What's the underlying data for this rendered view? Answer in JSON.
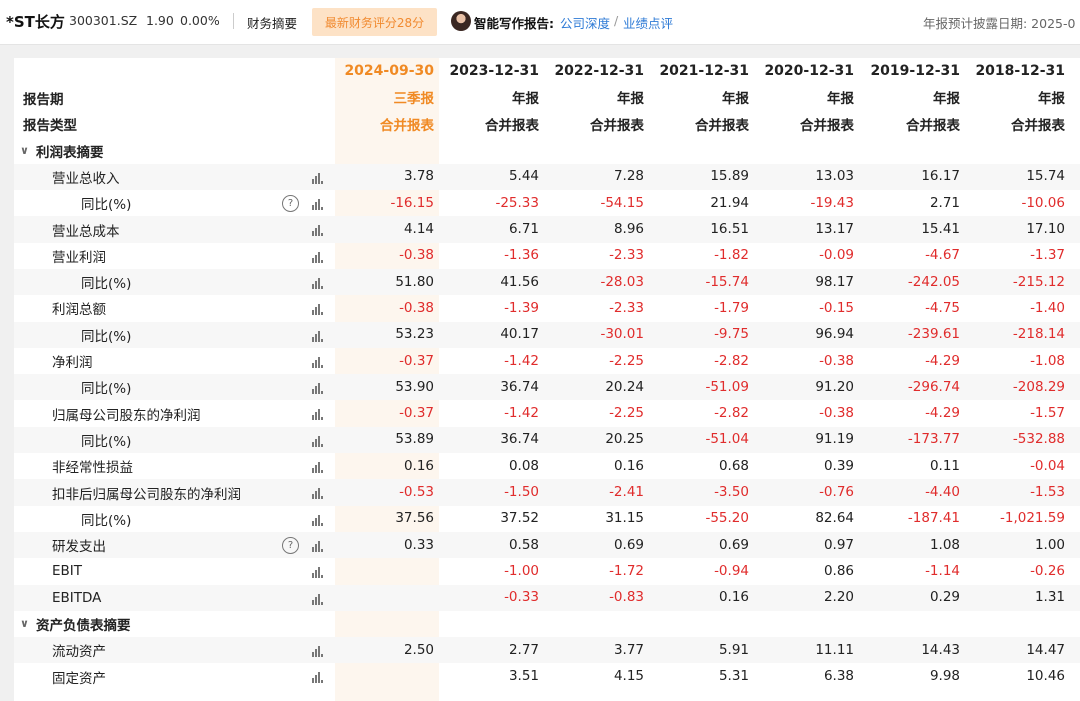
{
  "topbar": {
    "stock_name": "*ST长方",
    "stock_code": "300301.SZ",
    "price": "1.90",
    "change": "0.00%",
    "tab_summary": "财务摘要",
    "score_button": "最新财务评分28分",
    "ai_label": "智能写作报告:",
    "ai_link1": "公司深度",
    "ai_sep": "/",
    "ai_link2": "业绩点评",
    "disclosure": "年报预计披露日期: 2025-0"
  },
  "header": {
    "dates": [
      "2024-09-30",
      "2023-12-31",
      "2022-12-31",
      "2021-12-31",
      "2020-12-31",
      "2019-12-31",
      "2018-12-31"
    ],
    "period_label": "报告期",
    "periods": [
      "三季报",
      "年报",
      "年报",
      "年报",
      "年报",
      "年报",
      "年报"
    ],
    "type_label": "报告类型",
    "types": [
      "合并报表",
      "合并报表",
      "合并报表",
      "合并报表",
      "合并报表",
      "合并报表",
      "合并报表"
    ]
  },
  "sections": {
    "income": "利润表摘要",
    "balance": "资产负债表摘要"
  },
  "rows": [
    {
      "label": "营业总收入",
      "level": 1,
      "help": false,
      "values": [
        "3.78",
        "5.44",
        "7.28",
        "15.89",
        "13.03",
        "16.17",
        "15.74"
      ]
    },
    {
      "label": "同比(%)",
      "level": 2,
      "help": true,
      "values": [
        "-16.15",
        "-25.33",
        "-54.15",
        "21.94",
        "-19.43",
        "2.71",
        "-10.06"
      ]
    },
    {
      "label": "营业总成本",
      "level": 1,
      "help": false,
      "values": [
        "4.14",
        "6.71",
        "8.96",
        "16.51",
        "13.17",
        "15.41",
        "17.10"
      ]
    },
    {
      "label": "营业利润",
      "level": 1,
      "help": false,
      "values": [
        "-0.38",
        "-1.36",
        "-2.33",
        "-1.82",
        "-0.09",
        "-4.67",
        "-1.37"
      ]
    },
    {
      "label": "同比(%)",
      "level": 2,
      "help": false,
      "values": [
        "51.80",
        "41.56",
        "-28.03",
        "-15.74",
        "98.17",
        "-242.05",
        "-215.12"
      ]
    },
    {
      "label": "利润总额",
      "level": 1,
      "help": false,
      "values": [
        "-0.38",
        "-1.39",
        "-2.33",
        "-1.79",
        "-0.15",
        "-4.75",
        "-1.40"
      ]
    },
    {
      "label": "同比(%)",
      "level": 2,
      "help": false,
      "values": [
        "53.23",
        "40.17",
        "-30.01",
        "-9.75",
        "96.94",
        "-239.61",
        "-218.14"
      ]
    },
    {
      "label": "净利润",
      "level": 1,
      "help": false,
      "values": [
        "-0.37",
        "-1.42",
        "-2.25",
        "-2.82",
        "-0.38",
        "-4.29",
        "-1.08"
      ]
    },
    {
      "label": "同比(%)",
      "level": 2,
      "help": false,
      "values": [
        "53.90",
        "36.74",
        "20.24",
        "-51.09",
        "91.20",
        "-296.74",
        "-208.29"
      ]
    },
    {
      "label": "归属母公司股东的净利润",
      "level": 1,
      "help": false,
      "values": [
        "-0.37",
        "-1.42",
        "-2.25",
        "-2.82",
        "-0.38",
        "-4.29",
        "-1.57"
      ]
    },
    {
      "label": "同比(%)",
      "level": 2,
      "help": false,
      "values": [
        "53.89",
        "36.74",
        "20.25",
        "-51.04",
        "91.19",
        "-173.77",
        "-532.88"
      ]
    },
    {
      "label": "非经常性损益",
      "level": 1,
      "help": false,
      "values": [
        "0.16",
        "0.08",
        "0.16",
        "0.68",
        "0.39",
        "0.11",
        "-0.04"
      ]
    },
    {
      "label": "扣非后归属母公司股东的净利润",
      "level": 1,
      "help": false,
      "values": [
        "-0.53",
        "-1.50",
        "-2.41",
        "-3.50",
        "-0.76",
        "-4.40",
        "-1.53"
      ]
    },
    {
      "label": "同比(%)",
      "level": 2,
      "help": false,
      "values": [
        "37.56",
        "37.52",
        "31.15",
        "-55.20",
        "82.64",
        "-187.41",
        "-1,021.59"
      ]
    },
    {
      "label": "研发支出",
      "level": 1,
      "help": true,
      "values": [
        "0.33",
        "0.58",
        "0.69",
        "0.69",
        "0.97",
        "1.08",
        "1.00"
      ]
    },
    {
      "label": "EBIT",
      "level": 1,
      "help": false,
      "values": [
        "",
        "-1.00",
        "-1.72",
        "-0.94",
        "0.86",
        "-1.14",
        "-0.26"
      ]
    },
    {
      "label": "EBITDA",
      "level": 1,
      "help": false,
      "values": [
        "",
        "-0.33",
        "-0.83",
        "0.16",
        "2.20",
        "0.29",
        "1.31"
      ]
    }
  ],
  "balance_rows": [
    {
      "label": "流动资产",
      "level": 1,
      "help": false,
      "values": [
        "2.50",
        "2.77",
        "3.77",
        "5.91",
        "11.11",
        "14.43",
        "14.47"
      ]
    },
    {
      "label": "固定资产",
      "level": 1,
      "help": false,
      "values": [
        "",
        "3.51",
        "4.15",
        "5.31",
        "6.38",
        "9.98",
        "10.46"
      ]
    }
  ],
  "icons": {
    "bar": "bar-chart-icon",
    "help": "question-icon",
    "caret": "chevron-down-icon"
  },
  "colors": {
    "negative": "#e02c2c",
    "accent": "#f08a24",
    "link": "#2f7bd6"
  }
}
